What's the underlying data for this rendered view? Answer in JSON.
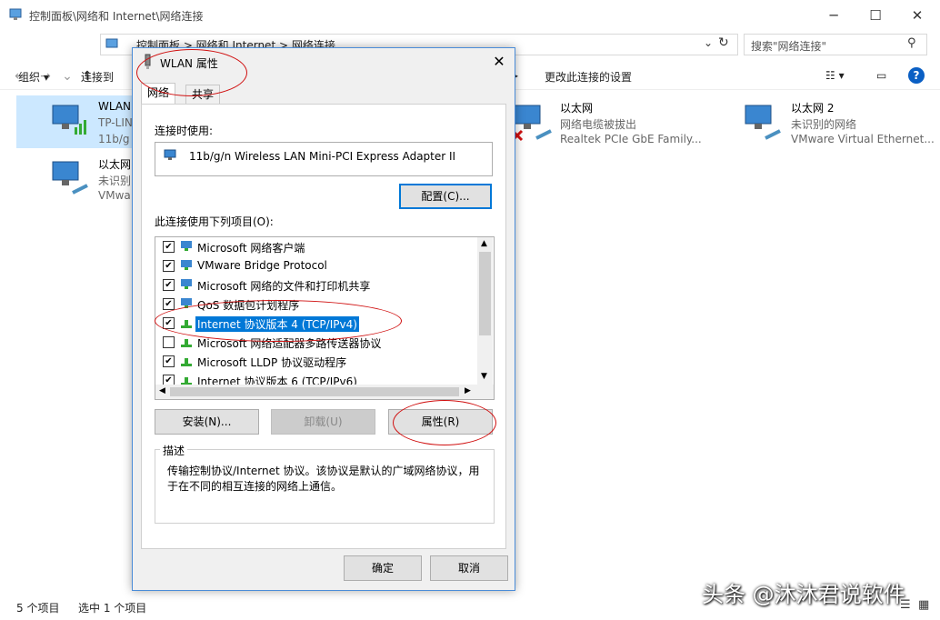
{
  "explorer": {
    "title": "控制面板\\网络和 Internet\\网络连接",
    "address": "控制面板  >  网络和 Internet  >  网络连接",
    "search_placeholder": "搜索\"网络连接\"",
    "toolbar": {
      "organize": "组织 ▾",
      "connect_to": "连接到",
      "change_settings": "更改此连接的设置"
    },
    "items": [
      {
        "name": "WLAN",
        "sub1": "TP-LIN",
        "sub2": "11b/g"
      },
      {
        "name": "以太网",
        "sub1": "未识别",
        "sub2": "VMwa"
      },
      {
        "name": "以太网",
        "sub1": "网络电缆被拔出",
        "sub2": "Realtek PCIe GbE Family..."
      },
      {
        "name": "以太网 2",
        "sub1": "未识别的网络",
        "sub2": "VMware Virtual Ethernet..."
      }
    ],
    "status_count": "5 个项目",
    "status_selected": "选中 1 个项目"
  },
  "dialog": {
    "title": "WLAN 属性",
    "tabs": [
      "网络",
      "共享"
    ],
    "connect_using_label": "连接时使用:",
    "adapter_name": "11b/g/n  Wireless LAN Mini-PCI Express Adapter II",
    "configure_button": "配置(C)...",
    "items_label": "此连接使用下列项目(O):",
    "items": [
      {
        "label": "Microsoft 网络客户端",
        "checked": true
      },
      {
        "label": "VMware Bridge Protocol",
        "checked": true
      },
      {
        "label": "Microsoft 网络的文件和打印机共享",
        "checked": true
      },
      {
        "label": "QoS 数据包计划程序",
        "checked": true
      },
      {
        "label": "Internet 协议版本 4 (TCP/IPv4)",
        "checked": true,
        "selected": true
      },
      {
        "label": "Microsoft 网络适配器多路传送器协议",
        "checked": false
      },
      {
        "label": "Microsoft LLDP 协议驱动程序",
        "checked": true
      },
      {
        "label": "Internet 协议版本 6 (TCP/IPv6)",
        "checked": true
      }
    ],
    "install_button": "安装(N)...",
    "uninstall_button": "卸载(U)",
    "properties_button": "属性(R)",
    "description_label": "描述",
    "description_text": "传输控制协议/Internet 协议。该协议是默认的广域网络协议，用于在不同的相互连接的网络上通信。",
    "ok_button": "确定",
    "cancel_button": "取消"
  },
  "watermark": "头条 @沐沐君说软件",
  "colors": {
    "accent": "#0078d7",
    "annotation": "#d01010"
  }
}
